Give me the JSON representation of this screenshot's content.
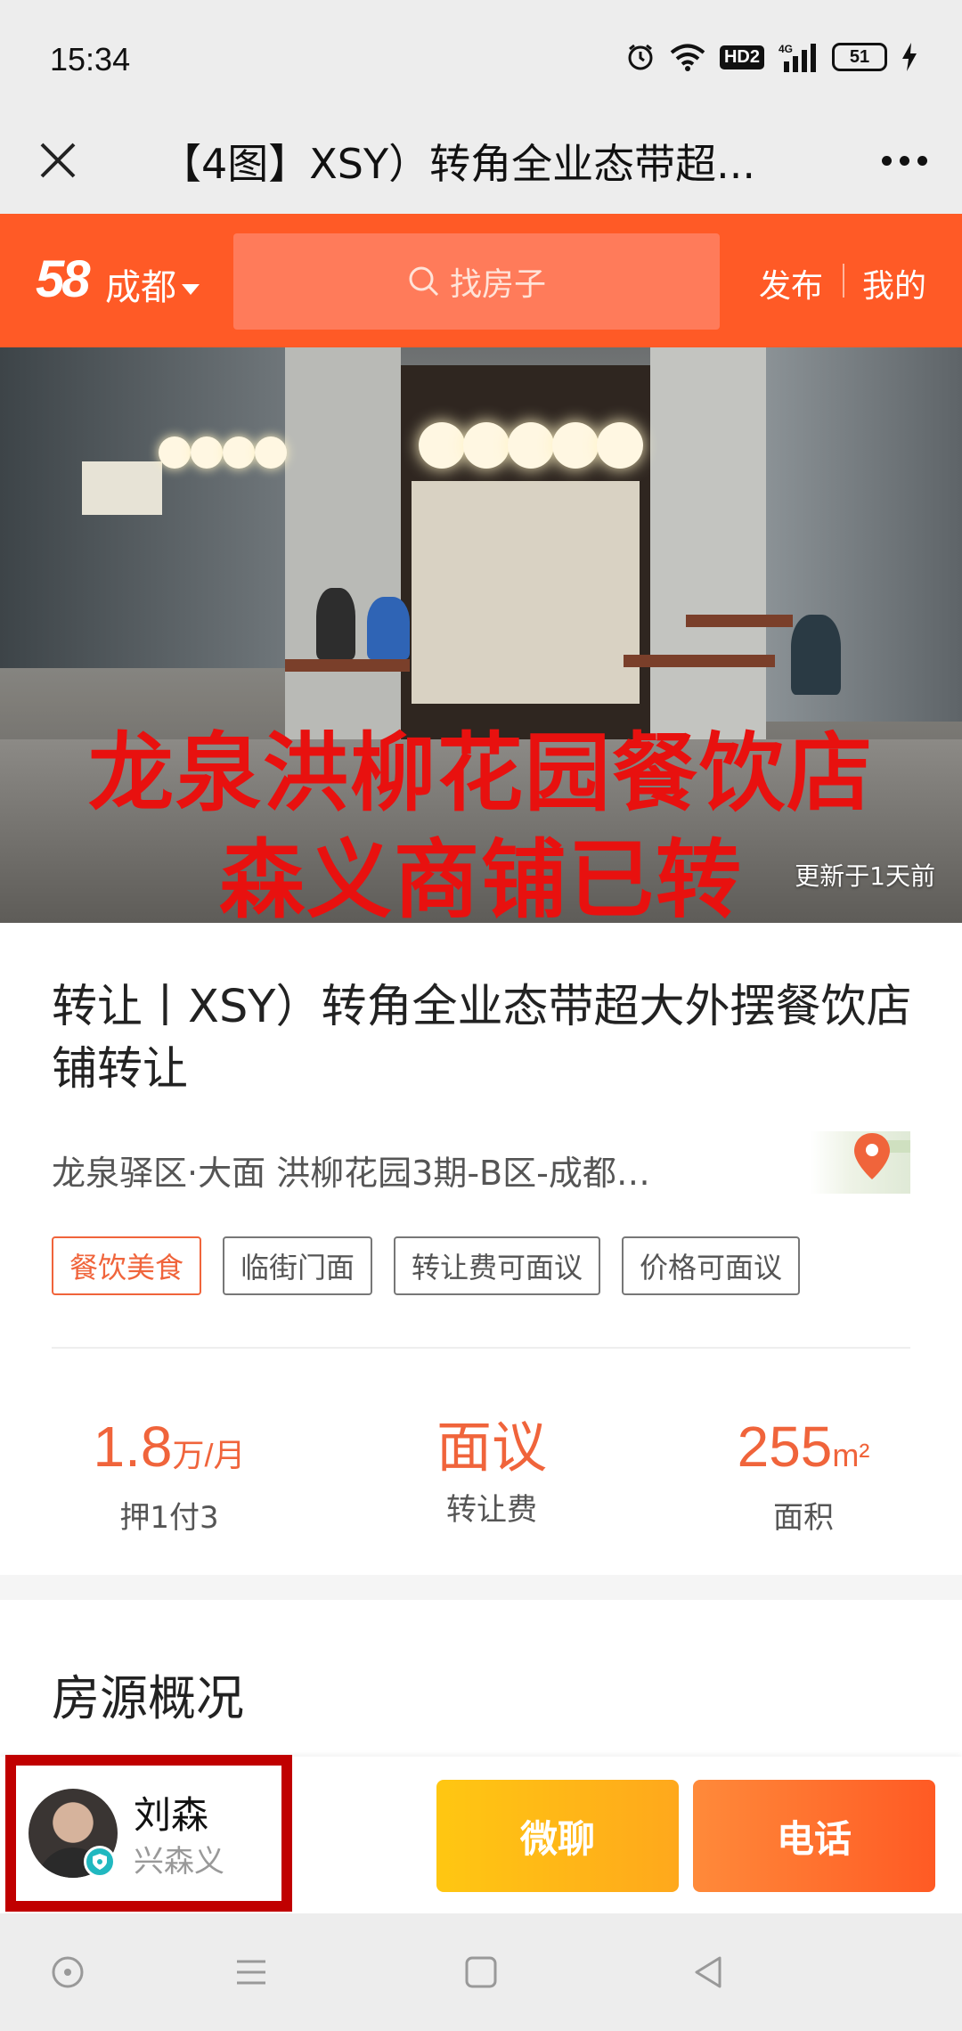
{
  "status_bar": {
    "time": "15:34",
    "hd_label": "HD2",
    "network_label": "4G",
    "battery_level": "51"
  },
  "title_bar": {
    "title": "【4图】XSY）转角全业态带超..."
  },
  "nav": {
    "logo": "58",
    "city": "成都",
    "search_placeholder": "找房子",
    "publish_label": "发布",
    "mine_label": "我的",
    "accent_color": "#ff5a26"
  },
  "hero": {
    "overlay_line1": "龙泉洪柳花园餐饮店",
    "overlay_line2": "森义商铺已转",
    "updated": "更新于1天前"
  },
  "listing": {
    "title": "转让丨XSY）转角全业态带超大外摆餐饮店铺转让",
    "address": "龙泉驿区·大面 洪柳花园3期-B区-成都…",
    "tags": [
      "餐饮美食",
      "临街门面",
      "转让费可面议",
      "价格可面议"
    ],
    "stats": {
      "rent": {
        "value": "1.8",
        "unit": "万/月",
        "label": "押1付3"
      },
      "transfer_fee": {
        "value": "面议",
        "label": "转让费"
      },
      "area": {
        "value": "255",
        "unit": "m²",
        "label": "面积"
      }
    }
  },
  "overview": {
    "title": "房源概况"
  },
  "agent": {
    "name": "刘森",
    "company": "兴森义",
    "chat_label": "微聊",
    "call_label": "电话"
  }
}
